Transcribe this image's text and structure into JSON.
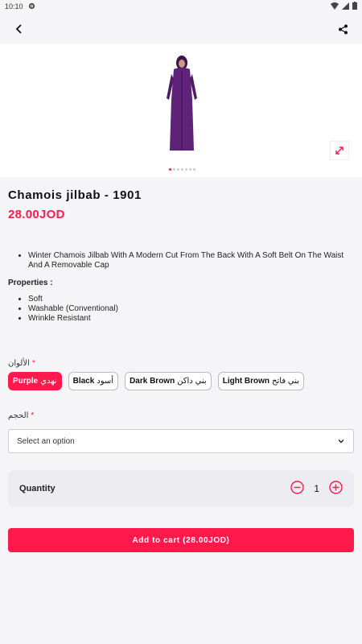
{
  "status_bar": {
    "time": "10:10"
  },
  "product": {
    "title": "Chamois jilbab - 1901",
    "price": "28.00JOD",
    "description_items": [
      "Winter Chamois Jilbab With A Modern Cut From The Back With A Soft Belt On The Waist And A Removable Cap"
    ],
    "properties_title": "Properties :",
    "properties": [
      "Soft",
      "Washable (Conventional)",
      "Wrinkle Resistant"
    ]
  },
  "colors": {
    "label": "الألوان",
    "required": "*",
    "options": [
      {
        "en": "Purple",
        "ar": "نهدي",
        "selected": true
      },
      {
        "en": "Black",
        "ar": "أسود",
        "selected": false
      },
      {
        "en": "Dark Brown",
        "ar": "بني داكن",
        "selected": false
      },
      {
        "en": "Light Brown",
        "ar": "بني فاتح",
        "selected": false
      }
    ]
  },
  "size": {
    "label": "الحجم",
    "required": "*",
    "placeholder": "Select an option"
  },
  "quantity": {
    "label": "Quantity",
    "value": "1"
  },
  "add_to_cart": {
    "label": "Add to cart (28.00JOD)"
  },
  "accent_color": "#ff1a4b"
}
